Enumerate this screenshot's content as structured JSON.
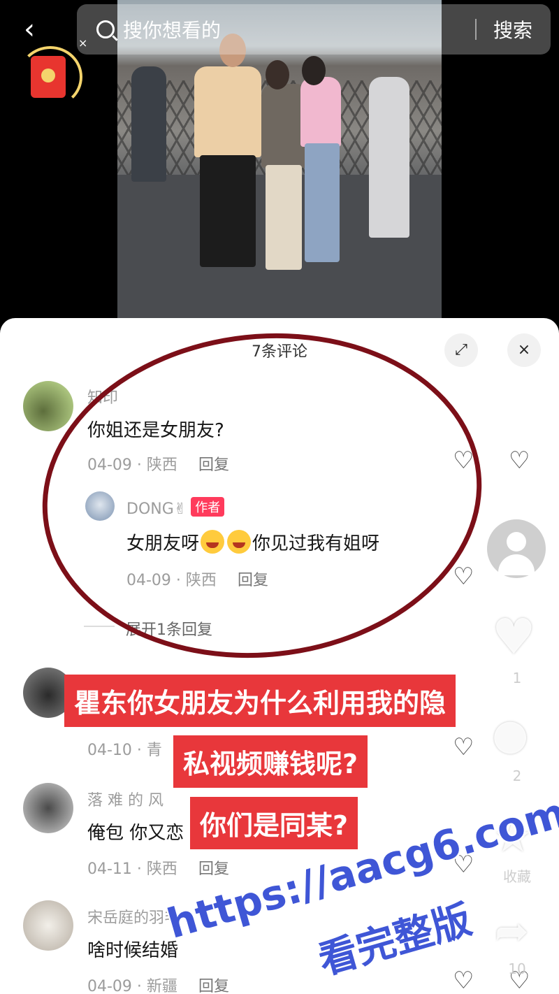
{
  "search": {
    "placeholder": "搜你想看的",
    "button": "搜索",
    "clear": "×"
  },
  "icons": {
    "back": "chevron-left-icon",
    "search": "search-icon",
    "red_packet": "red-packet-icon",
    "expand": "expand-icon",
    "close": "close-icon",
    "like": "heart-icon",
    "dislike": "broken-heart-icon",
    "comment": "comment-icon",
    "favorite": "star-icon",
    "share": "share-icon"
  },
  "sheet": {
    "title": "7条评论",
    "close": "×"
  },
  "comments": [
    {
      "name": "知印",
      "text": "你姐还是女朋友?",
      "date": "04-09",
      "location": "陕西",
      "reply_label": "回复"
    },
    {
      "name": "DONG✌",
      "author_tag": "作者",
      "text_before": "女朋友呀",
      "text_after": "你见过我有姐呀",
      "date": "04-09",
      "location": "陕西",
      "reply_label": "回复"
    },
    {
      "name": "……",
      "text": "",
      "date": "04-10",
      "location": "青",
      "reply_label": ""
    },
    {
      "name": "落 难 的 风",
      "text": "俺包 你又恋",
      "date": "04-11",
      "location": "陕西",
      "reply_label": "回复"
    },
    {
      "name": "宋岳庭的羽毛",
      "text": "啥时候结婚",
      "date": "04-09",
      "location": "新疆",
      "reply_label": "回复"
    }
  ],
  "expand_replies": "展开1条回复",
  "rail": {
    "like_count": "1",
    "comment_count": "2",
    "favorite_label": "收藏",
    "share_count": "10"
  },
  "captions": [
    "瞿东你女朋友为什么利用我的隐",
    "私视频赚钱呢?",
    "你们是同某?"
  ],
  "watermark": {
    "url": "https://aacg6.com",
    "text": "看完整版"
  },
  "colors": {
    "caption_bg": "#e8373b",
    "circle": "#7c0f18",
    "watermark": "#3f56d6",
    "author_tag": "#ff3b5c"
  }
}
